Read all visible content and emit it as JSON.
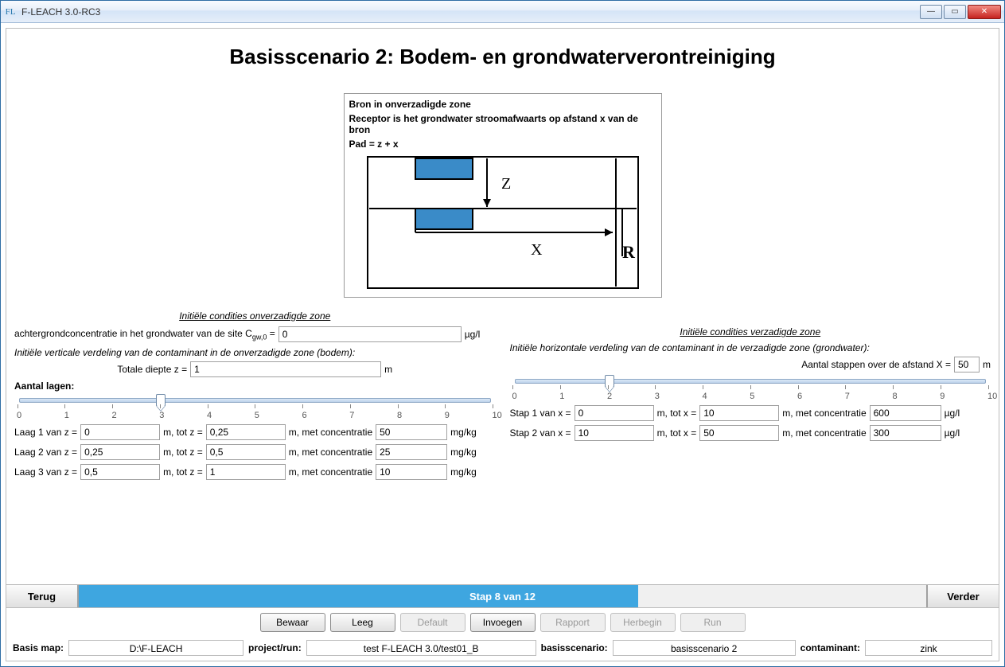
{
  "window": {
    "app_icon_text": "FL",
    "title": "F-LEACH 3.0-RC3"
  },
  "page_title": "Basisscenario 2: Bodem- en grondwaterverontreiniging",
  "diagram": {
    "line1": "Bron in onverzadigde zone",
    "line2": "Receptor is het grondwater stroomafwaarts op afstand x van de bron",
    "line3": "Pad = z + x",
    "label_z": "Z",
    "label_x": "X",
    "label_r": "R"
  },
  "left": {
    "header": "Initiële condities onverzadigde zone",
    "bg_label_pre": "achtergrondconcentratie in het grondwater van de site  C",
    "bg_sub": "gw,0",
    "bg_eq": " = ",
    "bg_value": "0",
    "bg_unit": "µg/l",
    "vert_dist": "Initiële verticale verdeling van de contaminant in de onverzadigde zone (bodem):",
    "depth_label": "Totale diepte        z =",
    "depth_value": "1",
    "depth_unit": "m",
    "slider_label": "Aantal lagen:",
    "slider_ticks": [
      "0",
      "1",
      "2",
      "3",
      "4",
      "5",
      "6",
      "7",
      "8",
      "9",
      "10"
    ],
    "slider_pos_pct": 30,
    "layers": [
      {
        "pre": "Laag 1 van z =",
        "from": "0",
        "mid": "m, tot z =",
        "to": "0,25",
        "conc_lbl": "m, met concentratie",
        "conc": "50",
        "unit": "mg/kg"
      },
      {
        "pre": "Laag 2 van z =",
        "from": "0,25",
        "mid": "m, tot z =",
        "to": "0,5",
        "conc_lbl": "m, met concentratie",
        "conc": "25",
        "unit": "mg/kg"
      },
      {
        "pre": "Laag 3 van z =",
        "from": "0,5",
        "mid": "m, tot z =",
        "to": "1",
        "conc_lbl": "m, met concentratie",
        "conc": "10",
        "unit": "mg/kg"
      }
    ]
  },
  "right": {
    "header": "Initiële condities verzadigde zone",
    "horiz_dist": "Initiële horizontale verdeling van de contaminant in de verzadigde zone (grondwater):",
    "steps_label": "Aantal stappen over de afstand X =",
    "steps_value": "50",
    "steps_unit": "m",
    "slider_ticks": [
      "0",
      "1",
      "2",
      "3",
      "4",
      "5",
      "6",
      "7",
      "8",
      "9",
      "10"
    ],
    "slider_pos_pct": 20,
    "steps": [
      {
        "pre": "Stap 1 van x =",
        "from": "0",
        "mid": "m, tot x =",
        "to": "10",
        "conc_lbl": "m, met concentratie",
        "conc": "600",
        "unit": "µg/l"
      },
      {
        "pre": "Stap 2 van x =",
        "from": "10",
        "mid": "m, tot x =",
        "to": "50",
        "conc_lbl": "m, met concentratie",
        "conc": "300",
        "unit": "µg/l"
      }
    ]
  },
  "nav": {
    "back": "Terug",
    "forward": "Verder",
    "progress_text": "Stap 8 van 12",
    "progress_pct": 66
  },
  "buttons": {
    "bewaar": "Bewaar",
    "leeg": "Leeg",
    "default": "Default",
    "invoegen": "Invoegen",
    "rapport": "Rapport",
    "herbegin": "Herbegin",
    "run": "Run"
  },
  "status": {
    "basis_map_lbl": "Basis map:",
    "basis_map_val": "D:\\F-LEACH",
    "project_lbl": "project/run:",
    "project_val": "test F-LEACH 3.0/test01_B",
    "scenario_lbl": "basisscenario:",
    "scenario_val": "basisscenario 2",
    "contaminant_lbl": "contaminant:",
    "contaminant_val": "zink"
  }
}
